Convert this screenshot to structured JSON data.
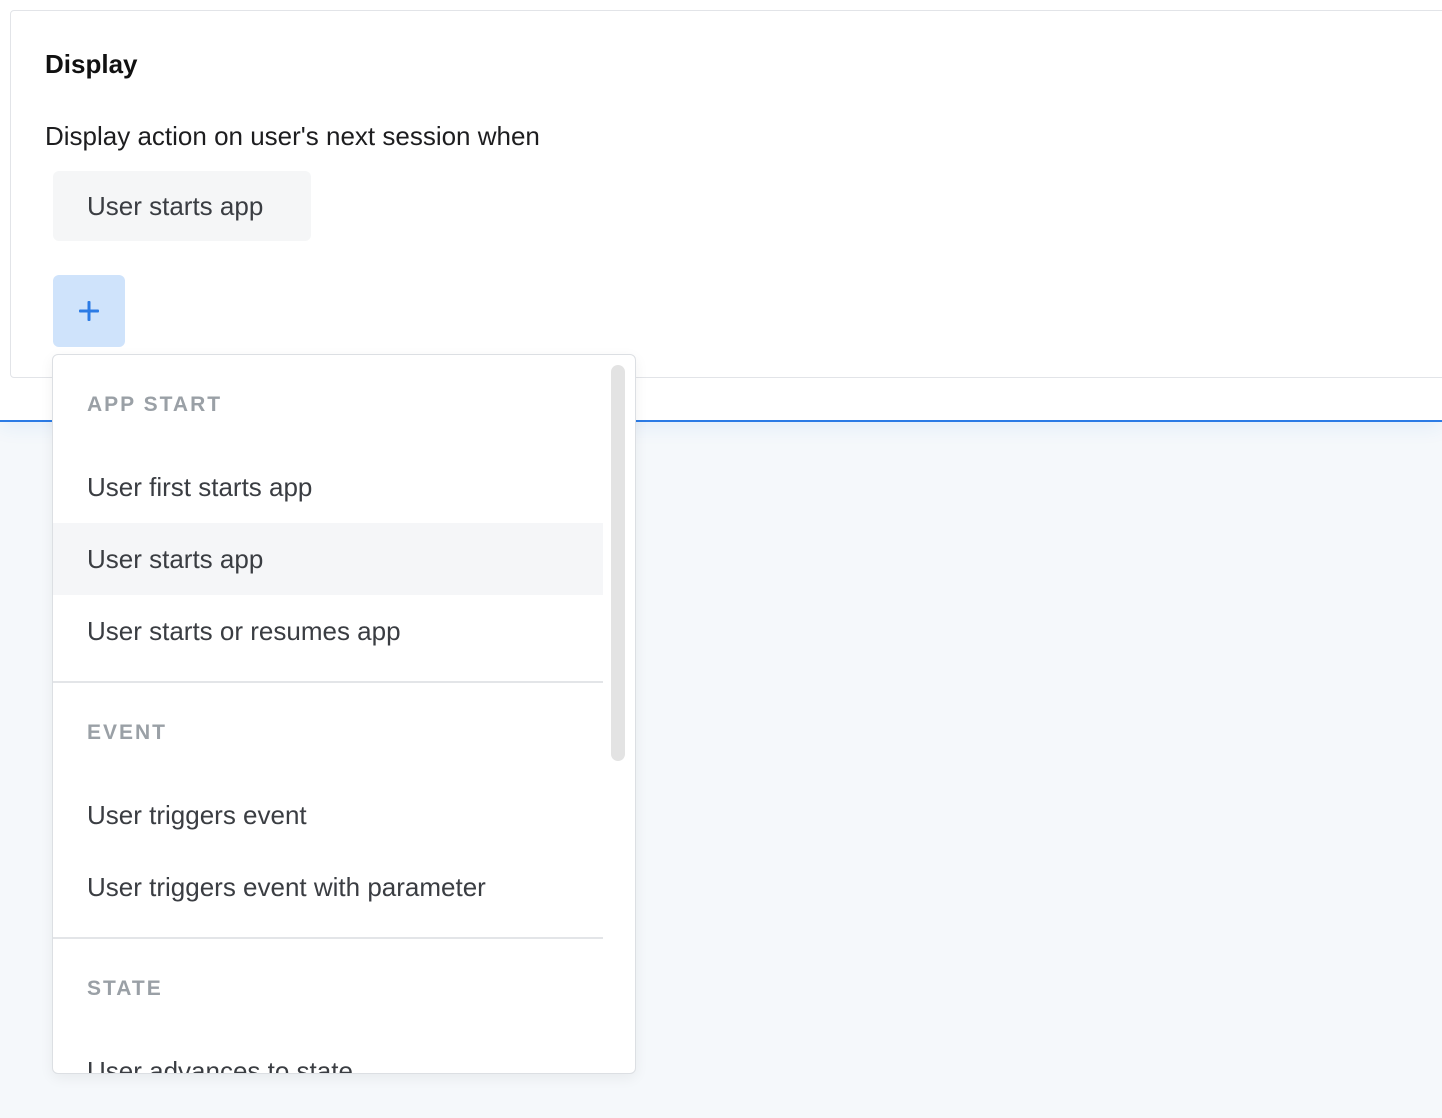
{
  "display": {
    "title": "Display",
    "description": "Display action on user's next session when",
    "selected_trigger": "User starts app",
    "add_label": "+"
  },
  "dropdown": {
    "groups": [
      {
        "header": "APP START",
        "items": [
          "User first starts app",
          "User starts app",
          "User starts or resumes app"
        ]
      },
      {
        "header": "EVENT",
        "items": [
          "User triggers event",
          "User triggers event with parameter"
        ]
      },
      {
        "header": "STATE",
        "items": [
          "User advances to state"
        ]
      }
    ],
    "highlighted_item": "User starts app"
  },
  "colors": {
    "accent": "#2c7be5",
    "add_button_bg": "#cfe3fb",
    "chip_bg": "#f5f6f7",
    "highlight_bg": "#f5f6f8",
    "group_header": "#9aa0a6",
    "page_bg": "#f5f8fb"
  },
  "icons": {
    "add_button": "plus-icon"
  }
}
